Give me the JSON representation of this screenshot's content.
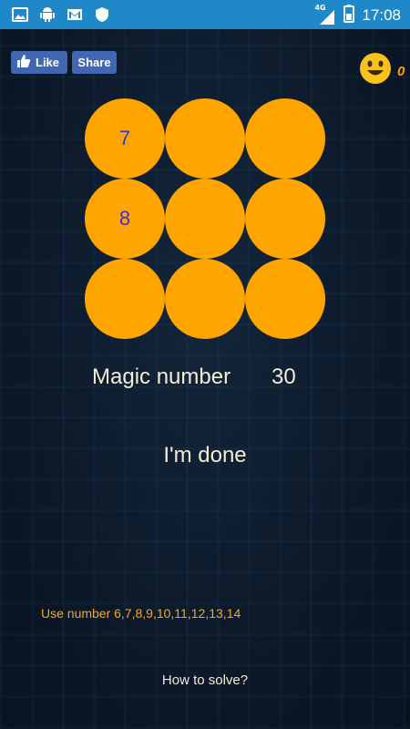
{
  "status_bar": {
    "time": "17:08",
    "network": "4G",
    "left_icons": [
      "image-icon",
      "android-icon",
      "gmail-icon",
      "shield-icon"
    ],
    "background": "#1e88c8"
  },
  "social": {
    "like_label": "Like",
    "share_label": "Share",
    "color": "#4267b2"
  },
  "score": {
    "value": "0",
    "icon": "smiley-icon",
    "color": "#ffa000"
  },
  "grid": {
    "cells": [
      "7",
      "",
      "",
      "8",
      "",
      "",
      "",
      "",
      ""
    ],
    "circle_color": "#ffa500",
    "number_color": "#3a32d4"
  },
  "magic": {
    "label": "Magic number",
    "value": "30"
  },
  "done_label": "I'm done",
  "hint": "Use number 6,7,8,9,10,11,12,13,14",
  "howto_label": "How to solve?"
}
